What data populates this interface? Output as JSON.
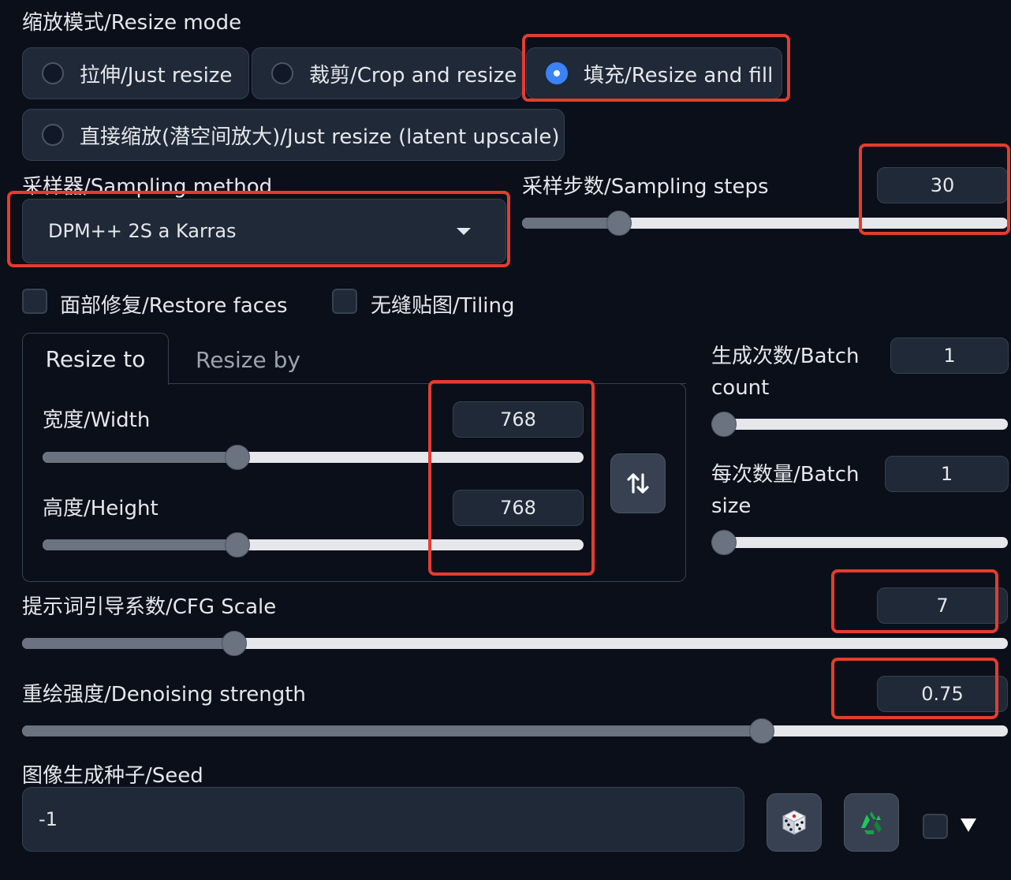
{
  "resize_mode": {
    "label": "缩放模式/Resize mode",
    "options": [
      {
        "label": "拉伸/Just resize",
        "selected": false
      },
      {
        "label": "裁剪/Crop and resize",
        "selected": false
      },
      {
        "label": "填充/Resize and fill",
        "selected": true
      },
      {
        "label": "直接缩放(潜空间放大)/Just resize (latent upscale)",
        "selected": false
      }
    ]
  },
  "sampler": {
    "label": "采样器/Sampling method",
    "value": "DPM++ 2S a Karras"
  },
  "steps": {
    "label": "采样步数/Sampling steps",
    "value": "30",
    "level": 0.2
  },
  "checkboxes": {
    "restore_faces": {
      "label": "面部修复/Restore faces",
      "checked": false
    },
    "tiling": {
      "label": "无缝贴图/Tiling",
      "checked": false
    }
  },
  "resize_tabs": {
    "tabs": [
      "Resize to",
      "Resize by"
    ],
    "active": "Resize to"
  },
  "width": {
    "label": "宽度/Width",
    "value": "768",
    "level": 0.36
  },
  "height": {
    "label": "高度/Height",
    "value": "768",
    "level": 0.36
  },
  "batch_count": {
    "label": "生成次数/Batch count",
    "value": "1",
    "level": 0.0
  },
  "batch_size": {
    "label": "每次数量/Batch size",
    "value": "1",
    "level": 0.0
  },
  "cfg": {
    "label": "提示词引导系数/CFG Scale",
    "value": "7",
    "level": 0.215
  },
  "denoise": {
    "label": "重绘强度/Denoising strength",
    "value": "0.75",
    "level": 0.75
  },
  "seed": {
    "label": "图像生成种子/Seed",
    "value": "-1"
  },
  "icons": {
    "swap": "swap-dimensions-icon",
    "dice": "dice-icon",
    "recycle": "recycle-icon",
    "extra": "triangle-down-icon"
  },
  "colors": {
    "background": "#0b0f19",
    "panel": "#1f2937",
    "accent": "#3b82f6",
    "highlight": "#e53c2f"
  }
}
